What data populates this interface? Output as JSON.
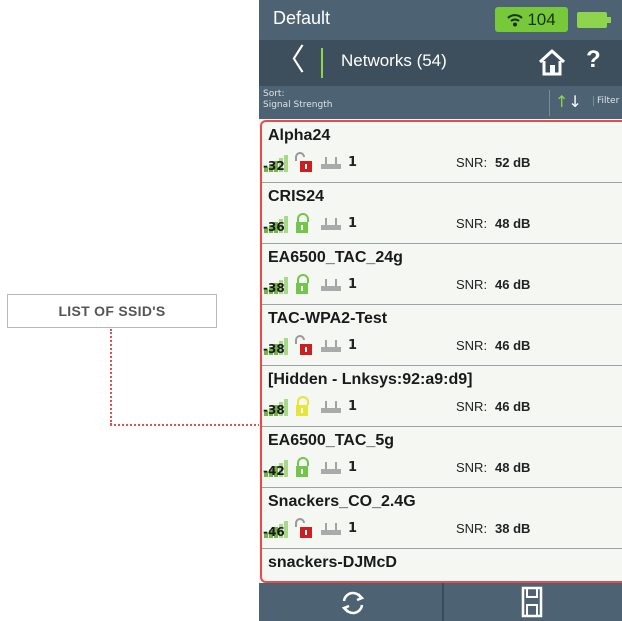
{
  "callout": {
    "label": "LIST OF SSID'S"
  },
  "status_bar": {
    "title": "Default",
    "wifi_count": "104"
  },
  "nav": {
    "back_icon": "chevron-left-icon",
    "title": "Networks (54)",
    "home_icon": "home-icon",
    "help_label": "?"
  },
  "sort": {
    "label_line1": "Sort:",
    "label_line2": "Signal Strength",
    "filter_label": "Filter"
  },
  "colors": {
    "accent": "#8fd44f",
    "header": "#4d6272",
    "highlight": "#e84b4b",
    "lock_locked": "#cc1f1f",
    "lock_open": "#74c54b",
    "lock_yellow": "#e6e63a"
  },
  "snr_label": "SNR:",
  "networks": [
    {
      "ssid": "Alpha24",
      "signal": "-32",
      "lock": "red",
      "ap_count": "1",
      "snr": "52 dB"
    },
    {
      "ssid": "CRIS24",
      "signal": "-36",
      "lock": "green",
      "ap_count": "1",
      "snr": "48 dB"
    },
    {
      "ssid": "EA6500_TAC_24g",
      "signal": "-38",
      "lock": "green",
      "ap_count": "1",
      "snr": "46 dB"
    },
    {
      "ssid": "TAC-WPA2-Test",
      "signal": "-38",
      "lock": "red",
      "ap_count": "1",
      "snr": "46 dB"
    },
    {
      "ssid": "[Hidden - Lnksys:92:a9:d9]",
      "signal": "-38",
      "lock": "yellow",
      "ap_count": "1",
      "snr": "46 dB"
    },
    {
      "ssid": "EA6500_TAC_5g",
      "signal": "-42",
      "lock": "green",
      "ap_count": "1",
      "snr": "48 dB"
    },
    {
      "ssid": "Snackers_CO_2.4G",
      "signal": "-46",
      "lock": "red",
      "ap_count": "1",
      "snr": "38 dB"
    }
  ],
  "partial_network": {
    "ssid": "snackers-DJMcD"
  },
  "footer": {
    "refresh_icon": "refresh-icon",
    "save_icon": "save-icon"
  }
}
